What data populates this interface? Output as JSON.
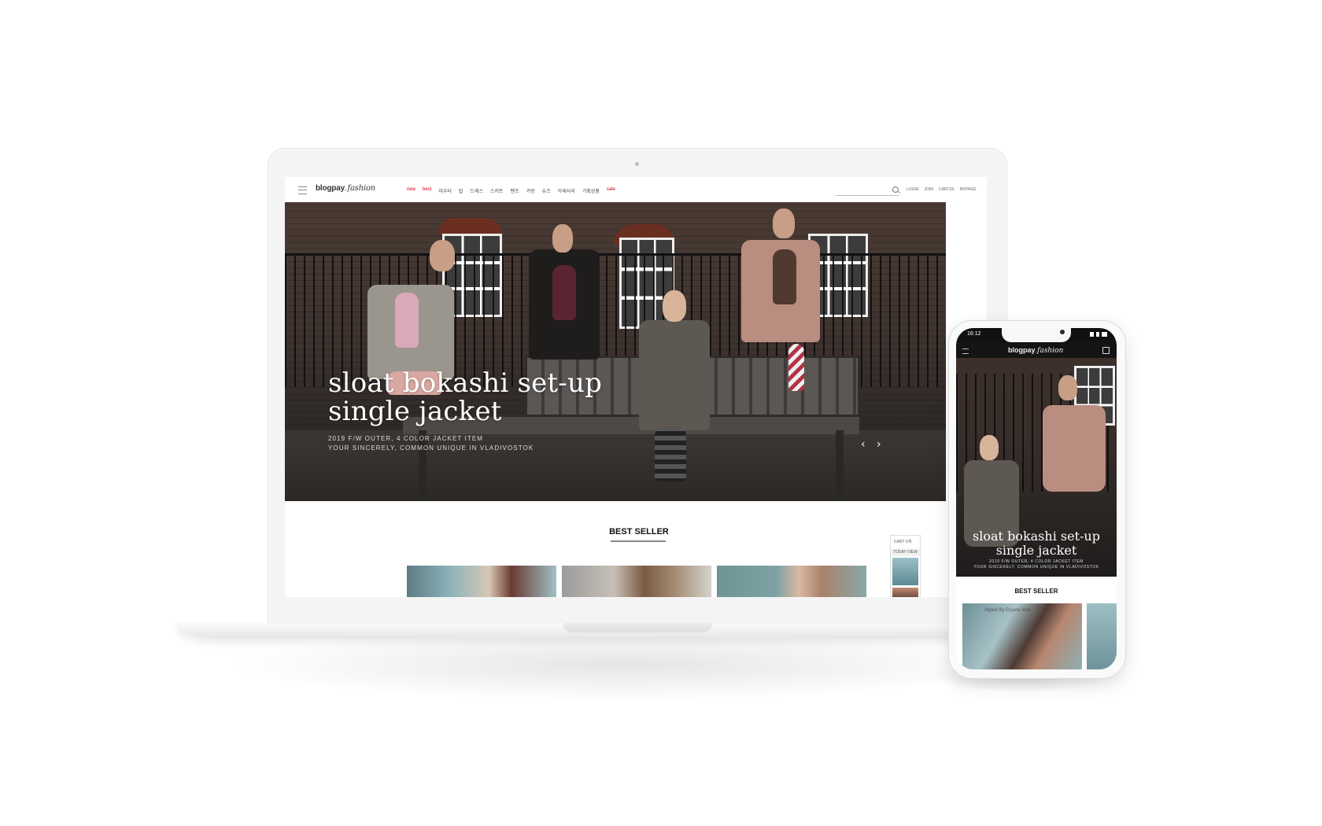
{
  "header": {
    "logo_main": "blogpay",
    "logo_script": "fashion",
    "nav": [
      "new",
      "best",
      "아우터",
      "탑",
      "드레스",
      "스커트",
      "팬츠",
      "가방",
      "슈즈",
      "악세사리",
      "기획상품",
      "sale"
    ],
    "nav_highlight": [
      "new",
      "best",
      "sale"
    ],
    "utility": [
      "LOGIN",
      "JOIN",
      "CART(0)",
      "MYPAGE"
    ]
  },
  "hero": {
    "title_line1": "sloat bokashi set-up",
    "title_line2": "single jacket",
    "subtitle_line1": "2019 F/W OUTER, 4 COLOR JACKET ITEM",
    "subtitle_line2": "YOUR SINCERELY, COMMON UNIQUE IN VLADIVOSTOK",
    "prev_icon": "‹",
    "next_icon": "›"
  },
  "best_seller": {
    "title": "BEST SELLER"
  },
  "side_widget": {
    "cart": "CART  0개",
    "today_view": "TODAY VIEW"
  },
  "mobile": {
    "time": "16:12",
    "logo_main": "blogpay",
    "logo_script": "fashion",
    "hero_title_line1": "sloat bokashi set-up",
    "hero_title_line2": "single jacket",
    "hero_sub_line1": "2019 F/W OUTER, 4 COLOR JACKET ITEM",
    "hero_sub_line2": "YOUR SINCERELY, COMMON UNIQUE IN VLADIVOSTOK",
    "best_title": "BEST SELLER",
    "product_caption": "Styled By Eryane Mall"
  },
  "colors": {
    "accent_red": "#d0021b",
    "device_silver": "#f4f4f5"
  }
}
